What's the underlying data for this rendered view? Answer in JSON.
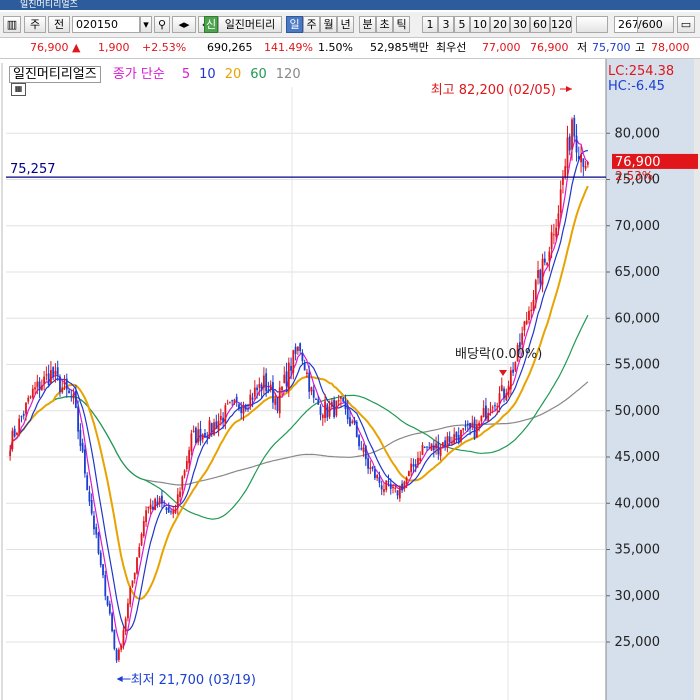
{
  "toolbar": {
    "market_tab": "주",
    "prev_label": "전",
    "code": "020150",
    "indicator_label": "일진머티리",
    "periods": [
      "일",
      "주",
      "월",
      "년",
      "분",
      "초",
      "틱"
    ],
    "intervals": [
      "1",
      "3",
      "5",
      "10",
      "20",
      "30",
      "60",
      "120"
    ],
    "count": "267",
    "count_total": "/600"
  },
  "quote": {
    "price": "76,900",
    "change": "1,900",
    "change_pct": "+2.53%",
    "volume": "690,265",
    "volume_ratio": "141.49%",
    "turnover": "1.50%",
    "trade_value": "52,985백만",
    "best_bid_label": "최우선",
    "best_ask": "77,000",
    "best_bid": "76,900",
    "low_label": "저",
    "low": "75,700",
    "high_label": "고",
    "high": "78,000"
  },
  "chart_data": {
    "type": "candlestick",
    "title": "일진머티리얼즈",
    "legend_prefix": "종가 단순",
    "ma_legend": [
      {
        "period": "5",
        "color": "#d81cd0"
      },
      {
        "period": "10",
        "color": "#1f36c9"
      },
      {
        "period": "20",
        "color": "#e8a300"
      },
      {
        "period": "60",
        "color": "#1f9a52"
      },
      {
        "period": "120",
        "color": "#888888"
      }
    ],
    "ylim": [
      21000,
      85000
    ],
    "y_ticks": [
      25000,
      30000,
      35000,
      40000,
      45000,
      50000,
      55000,
      60000,
      65000,
      70000,
      75000,
      80000
    ],
    "y_tick_labels": [
      "25,000",
      "30,000",
      "35,000",
      "40,000",
      "45,000",
      "50,000",
      "55,000",
      "60,000",
      "65,000",
      "70,000",
      "75,000",
      "80,000"
    ],
    "hline": {
      "value": 75257,
      "label": "75,257"
    },
    "current": {
      "value": 76900,
      "label": "76,900",
      "pct": "2.53%"
    },
    "lc": "LC:254.38",
    "hc": "HC:-6.45",
    "annotations": {
      "high": "최고 82,200 (02/05)",
      "low": "최저 21,700 (03/19)",
      "dividend": "배당락(0.00%)"
    },
    "anchors": [
      [
        0,
        46500
      ],
      [
        10,
        52000
      ],
      [
        18,
        54000
      ],
      [
        28,
        51000
      ],
      [
        34,
        42000
      ],
      [
        40,
        33000
      ],
      [
        44,
        28000
      ],
      [
        47,
        22500
      ],
      [
        52,
        29000
      ],
      [
        60,
        39500
      ],
      [
        66,
        40000
      ],
      [
        72,
        38500
      ],
      [
        80,
        47000
      ],
      [
        88,
        48000
      ],
      [
        96,
        50000
      ],
      [
        104,
        51000
      ],
      [
        112,
        53000
      ],
      [
        118,
        51000
      ],
      [
        124,
        55000
      ],
      [
        128,
        57000
      ],
      [
        134,
        51000
      ],
      [
        140,
        50000
      ],
      [
        146,
        50500
      ],
      [
        152,
        48000
      ],
      [
        158,
        44000
      ],
      [
        164,
        42000
      ],
      [
        170,
        41000
      ],
      [
        176,
        43000
      ],
      [
        182,
        46000
      ],
      [
        188,
        46000
      ],
      [
        194,
        47000
      ],
      [
        200,
        47500
      ],
      [
        206,
        48000
      ],
      [
        212,
        51000
      ],
      [
        218,
        52000
      ],
      [
        224,
        56000
      ],
      [
        230,
        62000
      ],
      [
        236,
        66000
      ],
      [
        242,
        72000
      ],
      [
        248,
        81000
      ],
      [
        252,
        78000
      ],
      [
        255,
        76900
      ]
    ]
  }
}
